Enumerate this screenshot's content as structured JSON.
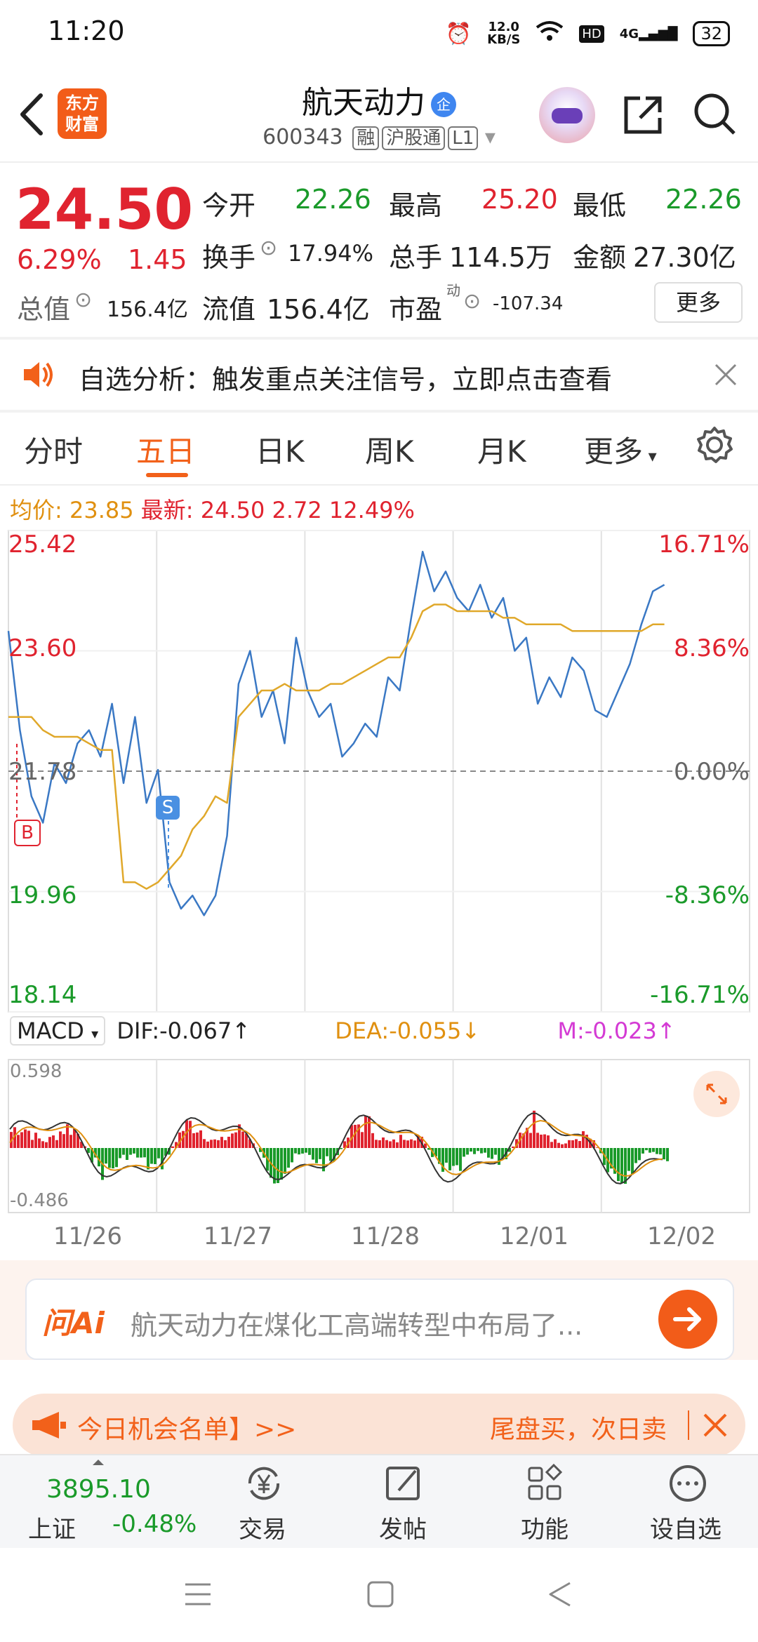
{
  "status": {
    "time": "11:20",
    "speed": "12.0\nKB/S",
    "speed_top": "12.0",
    "speed_bottom": "KB/S",
    "hd": "HD",
    "net": "4G",
    "battery": "32"
  },
  "header": {
    "title": "航天动力",
    "badge": "企",
    "code": "600343",
    "tags": [
      "融",
      "沪股通",
      "L1"
    ],
    "logo_line1": "东方",
    "logo_line2": "财富"
  },
  "quote": {
    "price": "24.50",
    "change_pct": "6.29%",
    "change": "1.45",
    "open_label": "今开",
    "open": "22.26",
    "high_label": "最高",
    "high": "25.20",
    "low_label": "最低",
    "low": "22.26",
    "turnover_label": "换手",
    "turnover": "17.94%",
    "volume_label": "总手",
    "volume": "114.5万",
    "amount_label": "金额",
    "amount": "27.30亿",
    "mktcap_label": "总值",
    "mktcap": "156.4亿",
    "float_label": "流值",
    "float": "156.4亿",
    "pe_label": "市盈",
    "pe_sup": "动",
    "pe": "-107.34",
    "more": "更多"
  },
  "notice": {
    "text": "自选分析：触发重点关注信号，立即点击查看"
  },
  "tabs": [
    {
      "label": "分时"
    },
    {
      "label": "五日"
    },
    {
      "label": "日K"
    },
    {
      "label": "周K"
    },
    {
      "label": "月K"
    },
    {
      "label": "更多"
    }
  ],
  "summary": {
    "avg_label": "均价:",
    "avg": "23.85",
    "latest_label": "最新:",
    "latest": "24.50",
    "chg": "2.72",
    "chg_pct": "12.49%"
  },
  "chart_data": {
    "type": "line",
    "price_axis": [
      "25.42",
      "23.60",
      "21.78",
      "19.96",
      "18.14"
    ],
    "pct_axis": [
      "16.71%",
      "8.36%",
      "0.00%",
      "-8.36%",
      "-16.71%"
    ],
    "x": [
      "11/26",
      "11/27",
      "11/28",
      "12/01",
      "12/02"
    ],
    "ylim": [
      18.14,
      25.42
    ],
    "marks": {
      "buy": "B",
      "sell": "S"
    },
    "series": [
      {
        "values": [
          23.9,
          22.4,
          21.4,
          21.0,
          21.9,
          21.6,
          22.2,
          22.4,
          22.0,
          22.8,
          21.6,
          22.6,
          21.3,
          21.8,
          20.1,
          19.7,
          19.9,
          19.6,
          19.9,
          20.8,
          23.1,
          23.6,
          22.6,
          23.0,
          22.2,
          23.8,
          23.0,
          22.6,
          22.8,
          22.0,
          22.2,
          22.5,
          22.3,
          23.2,
          23.0,
          24.1,
          25.1,
          24.5,
          24.8,
          24.4,
          24.2,
          24.6,
          24.1,
          24.4,
          23.6,
          23.8,
          22.8,
          23.2,
          22.9,
          23.5,
          23.3,
          22.7,
          22.6,
          23.0,
          23.4,
          24.0,
          24.5,
          24.6
        ]
      },
      {
        "values": [
          22.6,
          22.6,
          22.6,
          22.4,
          22.3,
          22.3,
          22.3,
          22.2,
          22.1,
          22.1,
          20.1,
          20.1,
          20.0,
          20.1,
          20.3,
          20.5,
          20.9,
          21.1,
          21.4,
          21.3,
          22.6,
          22.8,
          23.0,
          23.0,
          23.1,
          23.0,
          23.0,
          23.0,
          23.1,
          23.1,
          23.2,
          23.3,
          23.4,
          23.5,
          23.5,
          23.8,
          24.2,
          24.3,
          24.3,
          24.2,
          24.2,
          24.2,
          24.2,
          24.1,
          24.1,
          24.0,
          24.0,
          24.0,
          24.0,
          23.9,
          23.9,
          23.9,
          23.9,
          23.9,
          23.9,
          23.9,
          24.0,
          24.0
        ]
      }
    ]
  },
  "macd": {
    "label": "MACD",
    "dif_label": "DIF:",
    "dif": "-0.067",
    "dea_label": "DEA:",
    "dea": "-0.055",
    "m_label": "M:",
    "m": "-0.023",
    "max": "0.598",
    "min": "-0.486"
  },
  "ai": {
    "brand": "问Ai",
    "prompt": "航天动力在煤化工高端转型中布局了..."
  },
  "banner": {
    "left": "今日机会名单】>>",
    "right": "尾盘买，次日卖"
  },
  "bottom_nav": {
    "index_value": "3895.10",
    "index_name": "上证",
    "index_change": "-0.48%",
    "items": [
      {
        "label": "交易"
      },
      {
        "label": "发帖"
      },
      {
        "label": "功能"
      },
      {
        "label": "设自选"
      }
    ]
  }
}
